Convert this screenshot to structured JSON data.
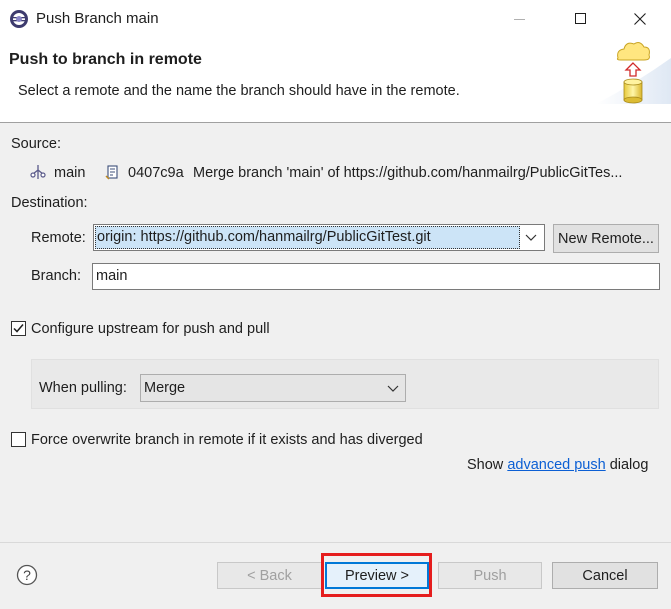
{
  "window": {
    "title": "Push Branch main",
    "app_icon": "eclipse-icon"
  },
  "header": {
    "title": "Push to branch in remote",
    "description": "Select a remote and the name the branch should have in the remote.",
    "graphic_icon": "push-to-cloud-icon"
  },
  "source": {
    "label": "Source:",
    "branch": "main",
    "commit_id": "0407c9a",
    "commit_message": "Merge branch 'main' of https://github.com/hanmailrg/PublicGitTes..."
  },
  "destination": {
    "label": "Destination:",
    "remote_label": "Remote:",
    "remote_value": "origin: https://github.com/hanmailrg/PublicGitTest.git",
    "new_remote_button": "New Remote...",
    "branch_label": "Branch:",
    "branch_value": "main"
  },
  "upstream": {
    "checkbox_label": "Configure upstream for push and pull",
    "checked": true,
    "when_pulling_label": "When pulling:",
    "when_pulling_value": "Merge"
  },
  "force": {
    "checkbox_label": "Force overwrite branch in remote if it exists and has diverged",
    "checked": false
  },
  "advanced": {
    "prefix": "Show",
    "link": "advanced push",
    "suffix": "dialog"
  },
  "buttons": {
    "back": "< Back",
    "preview": "Preview >",
    "push": "Push",
    "cancel": "Cancel"
  },
  "colors": {
    "highlight": "#e51d1d",
    "link": "#0b5fd4",
    "body_bg": "#f0f0f0"
  }
}
